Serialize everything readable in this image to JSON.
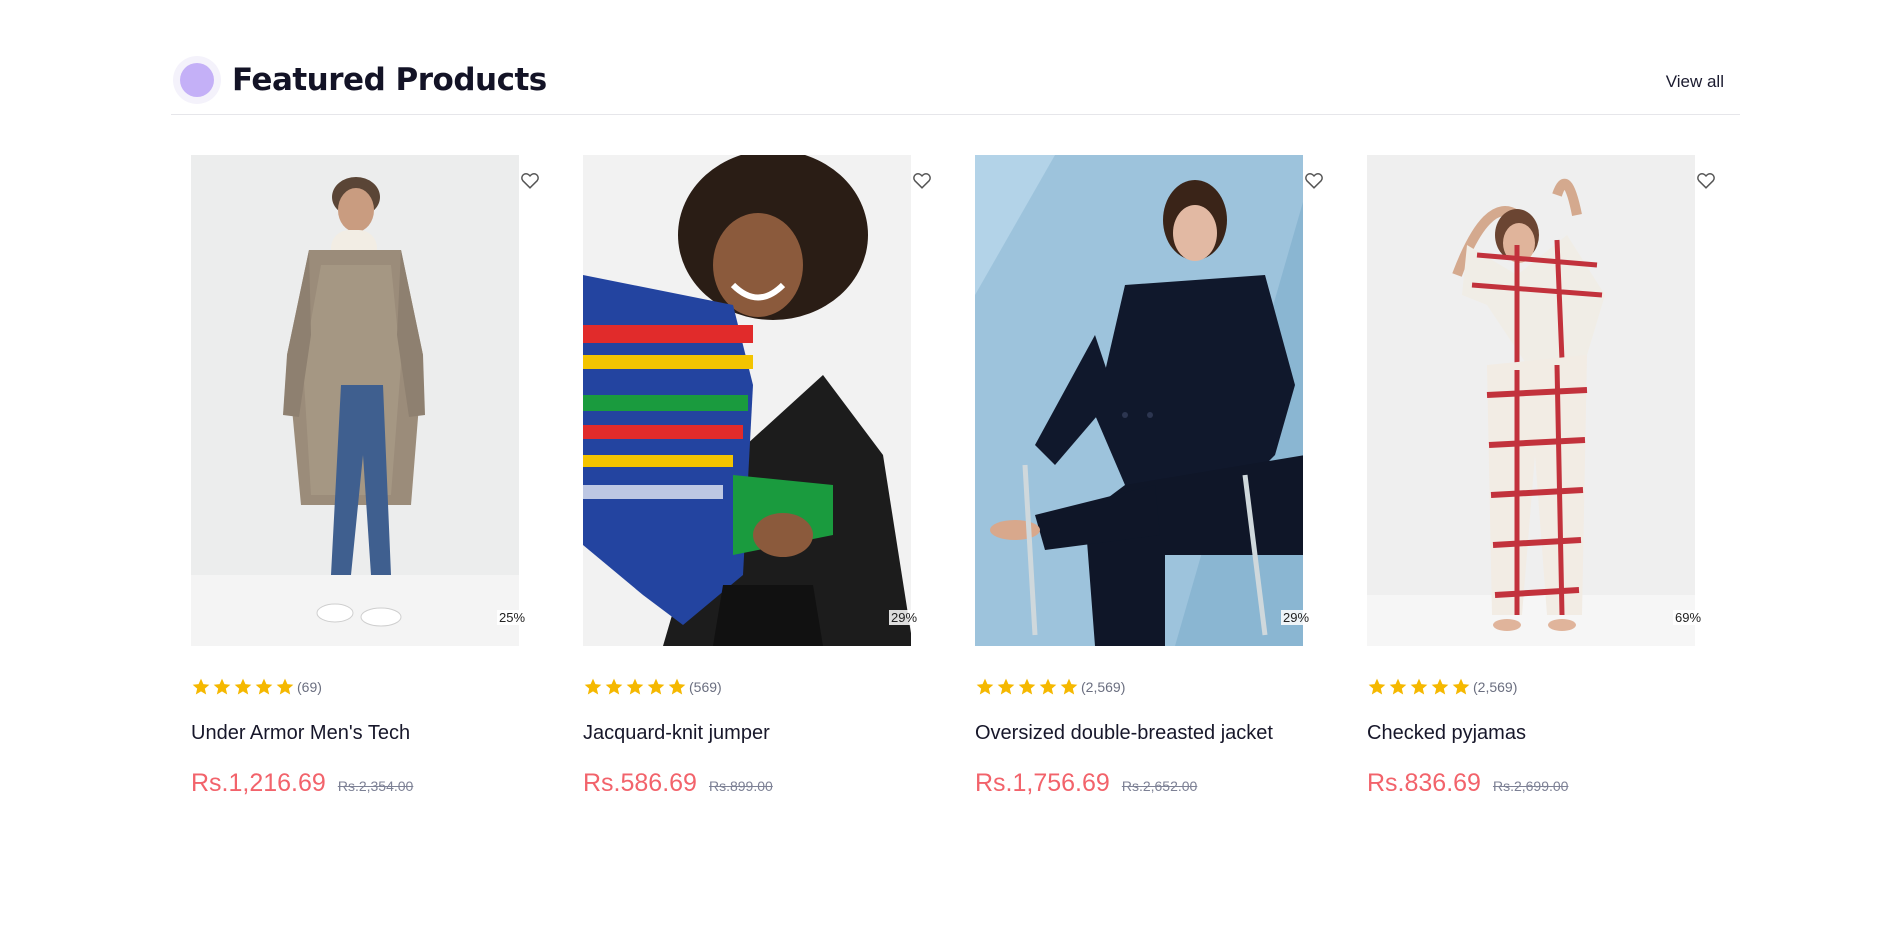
{
  "header": {
    "title": "Featured Products",
    "view_all_label": "View all",
    "accent_color": "#c4b0f7"
  },
  "products": [
    {
      "name": "Under Armor Men's Tech",
      "rating_stars": 5,
      "rating_count": "(69)",
      "price": "Rs.1,216.69",
      "old_price": "Rs.2,354.00",
      "discount": "25%",
      "wishlist_icon": "heart-outline-icon"
    },
    {
      "name": "Jacquard-knit jumper",
      "rating_stars": 5,
      "rating_count": "(569)",
      "price": "Rs.586.69",
      "old_price": "Rs.899.00",
      "discount": "29%",
      "wishlist_icon": "heart-outline-icon"
    },
    {
      "name": "Oversized double-breasted jacket",
      "rating_stars": 5,
      "rating_count": "(2,569)",
      "price": "Rs.1,756.69",
      "old_price": "Rs.2,652.00",
      "discount": "29%",
      "wishlist_icon": "heart-outline-icon"
    },
    {
      "name": "Checked pyjamas",
      "rating_stars": 5,
      "rating_count": "(2,569)",
      "price": "Rs.836.69",
      "old_price": "Rs.2,699.00",
      "discount": "69%",
      "wishlist_icon": "heart-outline-icon"
    }
  ],
  "colors": {
    "price": "#f2636b",
    "star": "#f5b800",
    "muted": "#7d8195"
  }
}
